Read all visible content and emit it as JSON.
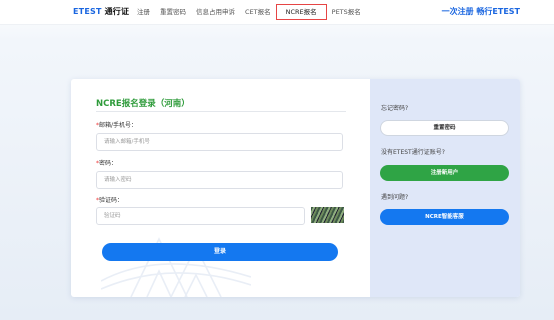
{
  "header": {
    "brand": "ETEST",
    "brand_suffix": "通行证",
    "nav": [
      "注册",
      "重置密码",
      "信息占用申诉",
      "CET报名",
      "NCRE报名",
      "PETS报名"
    ],
    "active_nav_index": 4,
    "slogan": "一次注册 畅行ETEST"
  },
  "form": {
    "title": "NCRE报名登录（河南）",
    "account_label": "邮箱/手机号：",
    "account_placeholder": "请输入邮箱/手机号",
    "password_label": "密码：",
    "password_placeholder": "请输入密码",
    "captcha_label": "验证码：",
    "captcha_placeholder": "验证码",
    "login_button": "登录"
  },
  "side": {
    "forgot_text": "忘记密码?",
    "reset_button": "重置密码",
    "no_account_text": "没有ETEST通行证账号?",
    "register_button": "注册新用户",
    "problem_text": "遇到问题?",
    "service_button": "NCRE智能客服"
  },
  "colors": {
    "brand_blue": "#1478f0",
    "title_green": "#2e9b3a",
    "register_green": "#2fa445",
    "active_tab_border": "#e64545"
  }
}
